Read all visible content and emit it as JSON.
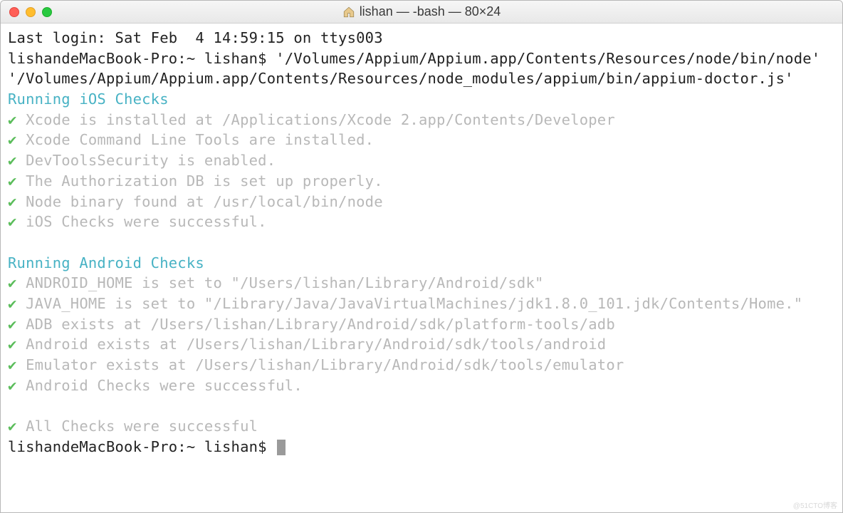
{
  "window": {
    "title": "lishan — -bash — 80×24"
  },
  "login_line": "Last login: Sat Feb  4 14:59:15 on ttys003",
  "prompt1": "lishandeMacBook-Pro:~ lishan$ ",
  "command": "'/Volumes/Appium/Appium.app/Contents/Resources/node/bin/node' '/Volumes/Appium/Appium.app/Contents/Resources/node_modules/appium/bin/appium-doctor.js'",
  "ios_header": "Running iOS Checks",
  "ios_checks": [
    "Xcode is installed at /Applications/Xcode 2.app/Contents/Developer",
    "Xcode Command Line Tools are installed.",
    "DevToolsSecurity is enabled.",
    "The Authorization DB is set up properly.",
    "Node binary found at /usr/local/bin/node",
    "iOS Checks were successful."
  ],
  "android_header": "Running Android Checks",
  "android_checks": [
    "ANDROID_HOME is set to \"/Users/lishan/Library/Android/sdk\"",
    "JAVA_HOME is set to \"/Library/Java/JavaVirtualMachines/jdk1.8.0_101.jdk/Contents/Home.\"",
    "ADB exists at /Users/lishan/Library/Android/sdk/platform-tools/adb",
    "Android exists at /Users/lishan/Library/Android/sdk/tools/android",
    "Emulator exists at /Users/lishan/Library/Android/sdk/tools/emulator",
    "Android Checks were successful."
  ],
  "final_check": "All Checks were successful",
  "prompt2": "lishandeMacBook-Pro:~ lishan$ ",
  "checkmark": "✔",
  "watermark": "@51CTO博客"
}
